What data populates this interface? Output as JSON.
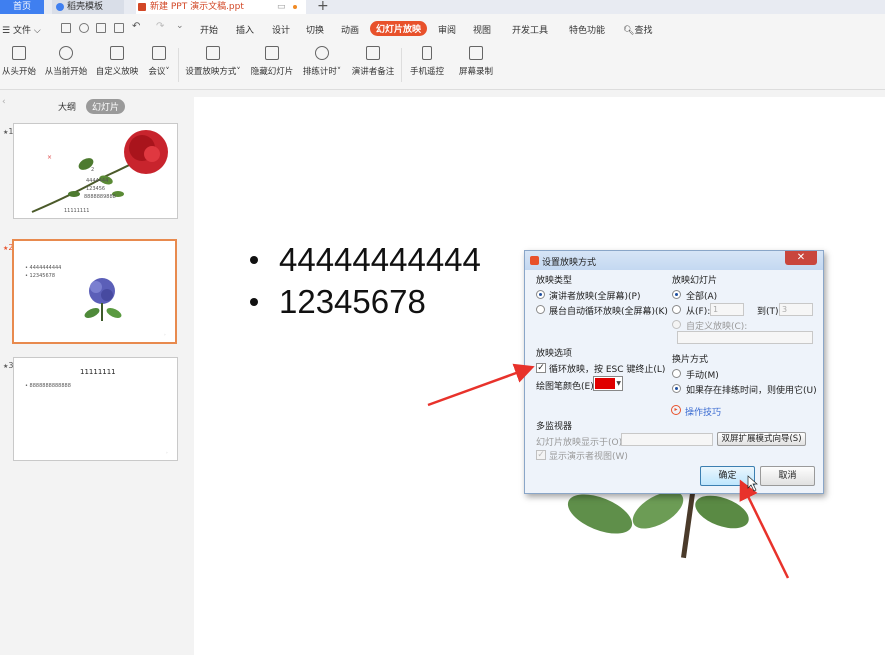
{
  "tabs": {
    "home": "首页",
    "template": "稻壳模板",
    "doc": "新建 PPT 演示文稿.ppt"
  },
  "menu": {
    "file": "文件",
    "items": [
      "开始",
      "插入",
      "设计",
      "切换",
      "动画",
      "幻灯片放映",
      "审阅",
      "视图",
      "开发工具",
      "特色功能",
      "查找"
    ]
  },
  "ribbon": {
    "from_start": "从头开始",
    "from_current": "从当前开始",
    "custom_show": "自定义放映",
    "meeting": "会议",
    "setup_show": "设置放映方式",
    "hide_slide": "隐藏幻灯片",
    "rehearse": "排练计时",
    "presenter_notes": "演讲者备注",
    "phone_remote": "手机遥控",
    "screen_record": "屏幕录制"
  },
  "panel": {
    "outline_tab": "大纲",
    "slides_tab": "幻灯片",
    "thumbs": [
      {
        "num": "1",
        "lines": [
          "2",
          "4444444",
          "123456",
          "8888889888",
          "11111111"
        ]
      },
      {
        "num": "2",
        "lines": [
          "4444444444",
          "12345678"
        ]
      },
      {
        "num": "3",
        "title": "11111111",
        "lines": [
          "8888888888888"
        ]
      }
    ]
  },
  "slide": {
    "bullets": [
      "44444444444",
      "12345678"
    ]
  },
  "dialog": {
    "title": "设置放映方式",
    "show_type": {
      "heading": "放映类型",
      "opt_speaker": "演讲者放映(全屏幕)(P)",
      "opt_kiosk": "展台自动循环放映(全屏幕)(K)"
    },
    "show_slides": {
      "heading": "放映幻灯片",
      "all": "全部(A)",
      "from": "从(F):",
      "from_value": "1",
      "to": "到(T):",
      "to_value": "3",
      "custom": "自定义放映(C):"
    },
    "show_options": {
      "heading": "放映选项",
      "loop": "循环放映，按 ESC 键终止(L)",
      "pen_color": "绘图笔颜色(E):",
      "pen_color_value": "#e00000"
    },
    "advance": {
      "heading": "换片方式",
      "manual": "手动(M)",
      "timings": "如果存在排练时间，则使用它(U)"
    },
    "tips_link": "操作技巧",
    "multi_monitor": {
      "heading": "多监视器",
      "show_on": "幻灯片放映显示于(O):",
      "wizard_button": "双屏扩展模式向导(S)",
      "presenter_view": "显示演示者视图(W)"
    },
    "ok": "确定",
    "cancel": "取消"
  },
  "colors": {
    "accent": "#e8512b",
    "home_tab": "#3f7ff0",
    "annotation_arrow": "#e8322b"
  }
}
